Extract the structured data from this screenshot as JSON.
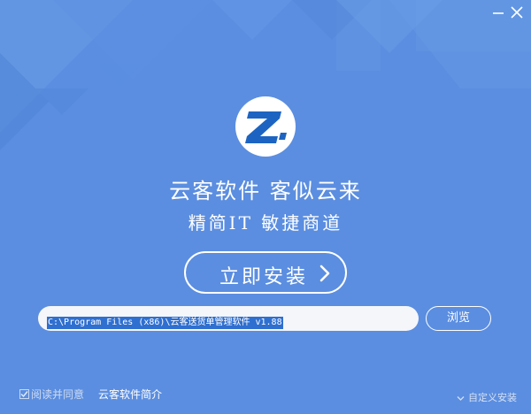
{
  "window": {
    "minimize_icon": "minimize-icon",
    "close_icon": "close-icon"
  },
  "brand": {
    "logo_icon": "z-brand-logo",
    "title": "云客软件  客似云来",
    "subtitle": "精简IT  敏捷商道"
  },
  "install": {
    "label": "立即安装",
    "arrow_icon": "chevron-right-icon"
  },
  "path": {
    "value": "C:\\Program Files (x86)\\云客送货单管理软件 v1.88"
  },
  "browse": {
    "label": "浏览"
  },
  "footer": {
    "agree_label": "阅读并同意",
    "agree_checked": true,
    "intro_label": "云客软件简介",
    "custom_label": "自定义安装",
    "custom_icon": "chevron-down-icon"
  },
  "colors": {
    "background": "#5b8ee0",
    "logo_blue": "#1d64c2",
    "selection": "#2f6fd0"
  }
}
